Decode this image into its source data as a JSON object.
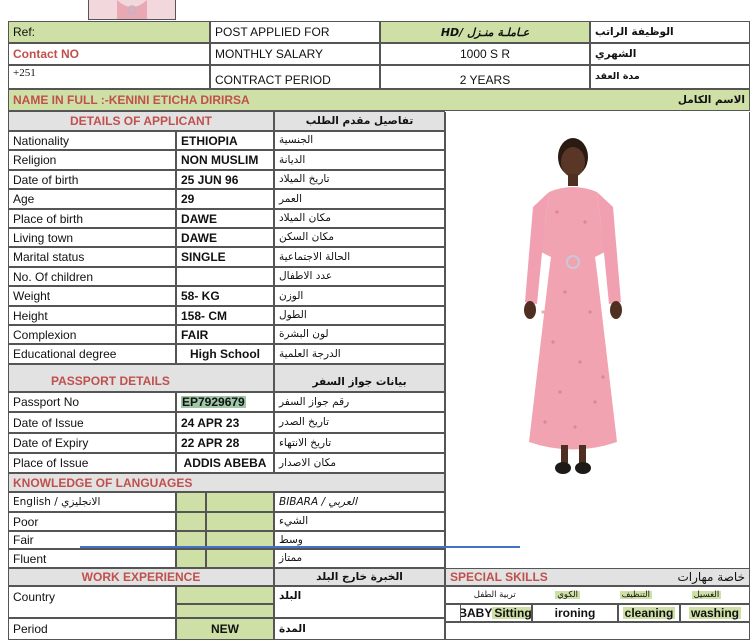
{
  "colors": {
    "green": "#cfe0a6",
    "grey": "#e2e2e2",
    "header_red": "#c0504d",
    "highlight": "#9fc6a6",
    "line_blue": "#4472c4"
  },
  "top": {
    "ref_label": "Ref:",
    "contact_label": "Contact NO",
    "phone_prefix": "+251",
    "post_label": "POST APPLIED FOR",
    "post_value": "HD/ عـاملـة منـزل",
    "post_ar": "الوظيفة الراتب",
    "salary_label": "MONTHLY SALARY",
    "salary_value": "1000 S R",
    "salary_ar": "الشهري",
    "contract_label": "CONTRACT PERIOD",
    "contract_value": "2 YEARS",
    "contract_ar": "مدة العقد"
  },
  "name": {
    "label": "NAME IN FULL :-KENINI ETICHA DIRIRSA",
    "ar": "الاسم الكامل"
  },
  "applicant": {
    "header": "DETAILS OF APPLICANT",
    "header_ar": "تفاصيل مقدم الطلب",
    "rows": [
      {
        "label": "Nationality",
        "value": "ETHIOPIA",
        "ar": "الجنسية"
      },
      {
        "label": "Religion",
        "value": "NON MUSLIM",
        "ar": "الديانة"
      },
      {
        "label": "Date of birth",
        "value": "25 JUN 96",
        "ar": "تاريخ الميلاد"
      },
      {
        "label": "Age",
        "value": "29",
        "ar": "العمر"
      },
      {
        "label": "Place of birth",
        "value": "DAWE",
        "ar": "مكان الميلاد"
      },
      {
        "label": "Living town",
        "value": "DAWE",
        "ar": "مكان السكن"
      },
      {
        "label": "Marital status",
        "value": "SINGLE",
        "ar": "الحالة الاجتماعية"
      },
      {
        "label": "No. Of children",
        "value": "",
        "ar": "عدد الاطفال"
      },
      {
        "label": "Weight",
        "value": "58- KG",
        "ar": "الوزن"
      },
      {
        "label": "Height",
        "value": "158- CM",
        "ar": "الطول"
      },
      {
        "label": "Complexion",
        "value": "FAIR",
        "ar": "لون البشرة"
      },
      {
        "label": "Educational degree",
        "value": "High School",
        "ar": "الدرجة العلمية"
      }
    ]
  },
  "passport": {
    "header": "PASSPORT DETAILS",
    "header_ar": "بيانات جواز السفر",
    "rows": [
      {
        "label": "Passport No",
        "value": "EP7929679",
        "ar": "رقم جواز السفر"
      },
      {
        "label": "Date of Issue",
        "value": "24 APR 23",
        "ar": "تاريخ الصدر"
      },
      {
        "label": "Date of Expiry",
        "value": "22 APR 28",
        "ar": "تاريخ الانتهاء"
      },
      {
        "label": "Place of Issue",
        "value": "ADDIS ABEBA",
        "ar": "مكان الاصدار"
      }
    ]
  },
  "languages": {
    "header": "KNOWLEDGE OF LANGUAGES",
    "english_label": "English / الانجليزي",
    "arabic_label": "العربي / BIBARA",
    "levels": [
      {
        "label": "Poor",
        "ar": "الشيء"
      },
      {
        "label": "Fair",
        "ar": "وسط"
      },
      {
        "label": "Fluent",
        "ar": "ممتاز"
      }
    ]
  },
  "work": {
    "header": "WORK EXPERIENCE",
    "header_ar": "الخبرة خارج البلد",
    "country_label": "Country",
    "country_ar": "البلد",
    "period_label": "Period",
    "period_value": "NEW",
    "period_ar": "المدة"
  },
  "skills": {
    "header": "SPECIAL SKILLS",
    "header_ar": "خاصة مهارات",
    "ar_items": [
      "تربية الطفل",
      "الكوي",
      "التنظيف",
      "الغسيل"
    ],
    "items": [
      {
        "prefix": "BABY ",
        "label": "Sitting"
      },
      {
        "prefix": "",
        "label": "ironing"
      },
      {
        "prefix": "",
        "label": "cleaning"
      },
      {
        "prefix": "",
        "label": "washing"
      }
    ]
  }
}
